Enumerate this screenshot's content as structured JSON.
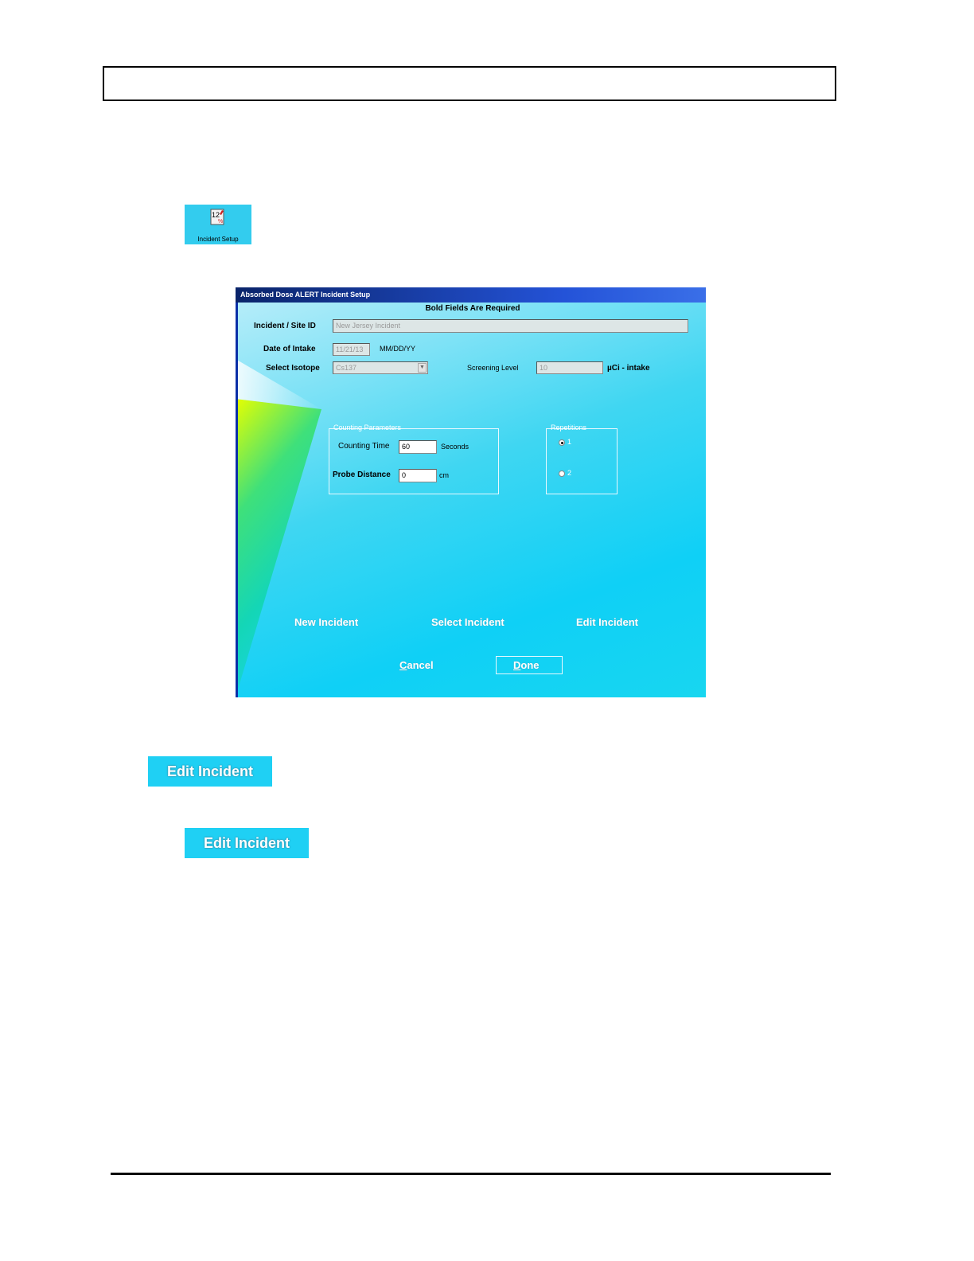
{
  "setup_icon": {
    "label": "Incident Setup",
    "icon": "clipboard-calendar-icon"
  },
  "dialog": {
    "title": "Absorbed Dose ALERT  Incident Setup",
    "required_note": "Bold Fields Are Required",
    "incident_site_label": "Incident / Site ID",
    "incident_site_value": "New Jersey Incident",
    "date_label": "Date of Intake",
    "date_value": "11/21/13",
    "date_format": "MM/DD/YY",
    "isotope_label": "Select Isotope",
    "isotope_value": "Cs137",
    "screening_label": "Screening Level",
    "screening_value": "10",
    "screening_unit": "µCi - intake",
    "counting_group_title": "Counting Parameters",
    "counting_time_label": "Counting Time",
    "counting_time_value": "60",
    "counting_time_unit": "Seconds",
    "probe_distance_label": "Probe Distance",
    "probe_distance_value": "0",
    "probe_distance_unit": "cm",
    "repetitions_title": "Repetitions",
    "repetition_options": [
      "1",
      "2"
    ],
    "new_incident": "New Incident",
    "select_incident": "Select Incident",
    "edit_incident": "Edit Incident",
    "cancel_first": "C",
    "cancel_rest": "ancel",
    "done_first": "D",
    "done_rest": "one"
  },
  "edit_button_1": "Edit Incident",
  "edit_button_2": "Edit Incident"
}
